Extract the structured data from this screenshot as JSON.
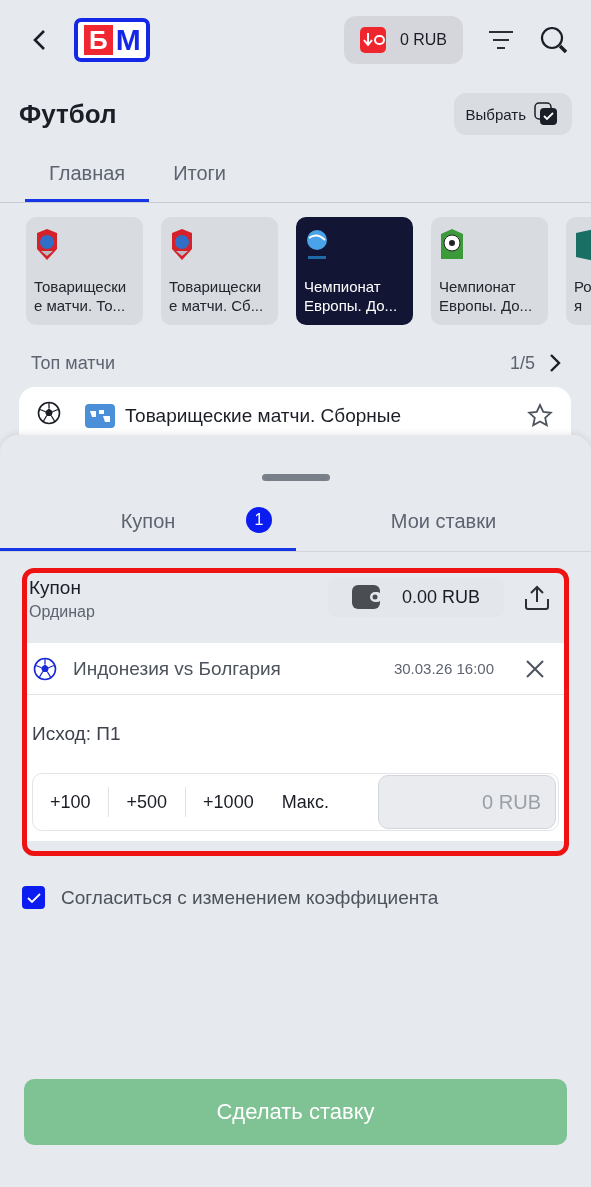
{
  "header": {
    "logo": [
      "Б",
      "М"
    ],
    "balance": "0 RUB"
  },
  "title": "Футбол",
  "select_button": "Выбрать",
  "tabs": [
    {
      "label": "Главная",
      "selected": true
    },
    {
      "label": "Итоги",
      "selected": false
    }
  ],
  "leagues": [
    {
      "kind": "shield",
      "lines": [
        "Товарищески",
        "е матчи. То..."
      ],
      "selected": false
    },
    {
      "kind": "shield",
      "lines": [
        "Товарищески",
        "е матчи. Сб..."
      ],
      "selected": false
    },
    {
      "kind": "globe",
      "lines": [
        "Чемпионат",
        "Европы. До..."
      ],
      "selected": true
    },
    {
      "kind": "field",
      "lines": [
        "Чемпионат",
        "Европы. До..."
      ],
      "selected": false
    },
    {
      "kind": "hex",
      "lines": [
        "Ро",
        "я"
      ],
      "selected": false
    }
  ],
  "top_matches": {
    "label": "Топ матчи",
    "pager": "1/5",
    "card_title": "Товарищеские матчи. Сборные"
  },
  "sheet": {
    "tabs": [
      {
        "label": "Купон",
        "badge": "1",
        "selected": true
      },
      {
        "label": "Мои ставки",
        "selected": false
      }
    ],
    "coupon": {
      "title": "Купон",
      "type": "Ординар",
      "balance": "0.00 RUB",
      "highlighted": true,
      "event": {
        "teams": "Индонезия vs Болгария",
        "datetime": "30.03.26 16:00"
      },
      "outcome": "Исход: П1",
      "quick_amounts": [
        "+100",
        "+500",
        "+1000",
        "Макс."
      ],
      "stake_placeholder": "0 RUB"
    },
    "accept_changes": {
      "label": "Согласиться с изменением коэффициента",
      "checked": true
    },
    "submit": {
      "label": "Сделать ставку",
      "disabled": true
    }
  }
}
